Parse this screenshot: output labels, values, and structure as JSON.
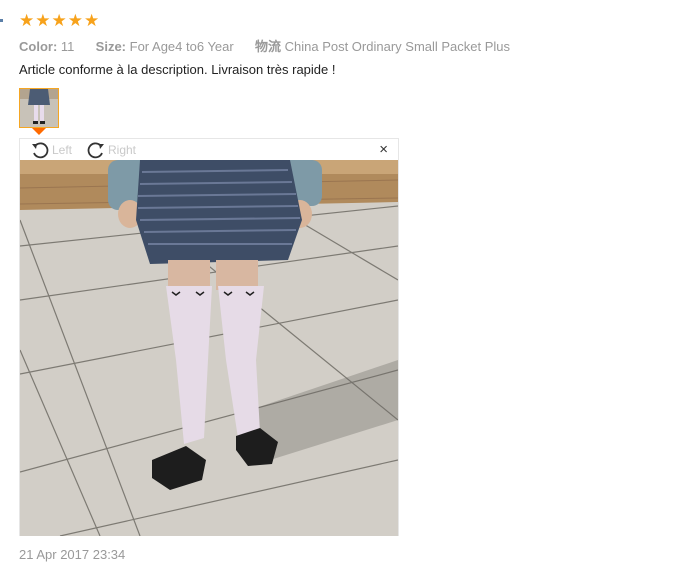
{
  "review": {
    "rating": 5,
    "stars": [
      "★",
      "★",
      "★",
      "★",
      "★"
    ],
    "star_color": "#f7a21b",
    "color_label": "Color:",
    "color_value": "11",
    "size_label": "Size:",
    "size_value": "For Age4 to6 Year",
    "shipping_label": "物流",
    "shipping_value": "China Post Ordinary Small Packet Plus",
    "text": "Article conforme à la description. Livraison très rapide !",
    "date": "21 Apr 2017 23:34"
  },
  "viewer": {
    "rotate_left_label": "Left",
    "rotate_right_label": "Right",
    "close_glyph": "×"
  },
  "colors": {
    "thumb_border": "#f5a623",
    "caret": "#ff6a00"
  }
}
